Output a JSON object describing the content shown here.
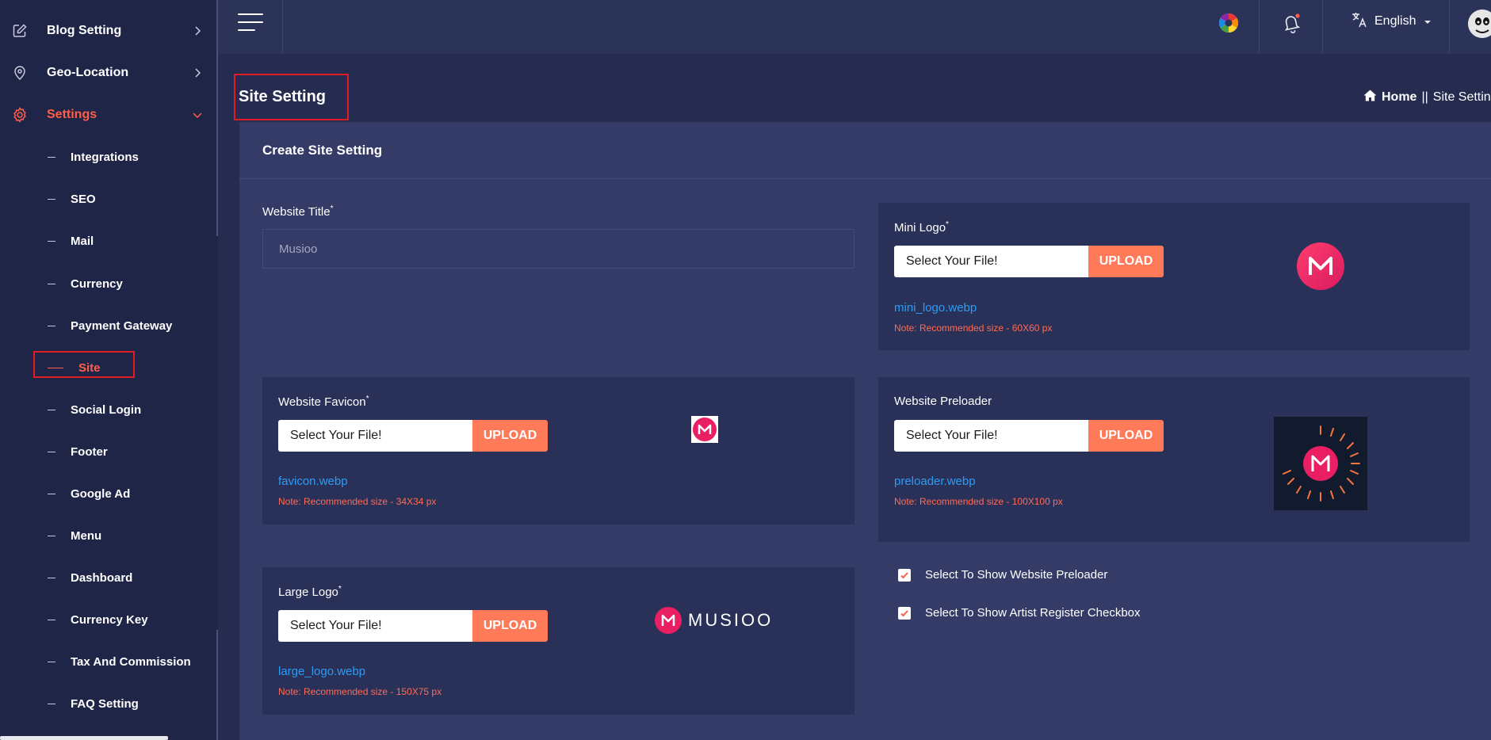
{
  "sidebar": {
    "items": [
      {
        "label": "Blog Setting",
        "icon": "edit-icon"
      },
      {
        "label": "Geo-Location",
        "icon": "location-pin-icon"
      },
      {
        "label": "Settings",
        "icon": "gear-icon"
      }
    ],
    "sub_items": [
      {
        "label": "Integrations"
      },
      {
        "label": "SEO"
      },
      {
        "label": "Mail"
      },
      {
        "label": "Currency"
      },
      {
        "label": "Payment Gateway"
      },
      {
        "label": "Site"
      },
      {
        "label": "Social Login"
      },
      {
        "label": "Footer"
      },
      {
        "label": "Google Ad"
      },
      {
        "label": "Menu"
      },
      {
        "label": "Dashboard"
      },
      {
        "label": "Currency Key"
      },
      {
        "label": "Tax And Commission"
      },
      {
        "label": "FAQ Setting"
      }
    ],
    "active_item": "Settings",
    "active_sub_item": "Site",
    "accent_color": "#ff5f4a"
  },
  "header": {
    "language": "English"
  },
  "page": {
    "title": "Site Setting",
    "breadcrumb": {
      "home": "Home",
      "separator": "||",
      "current": "Site Setting"
    }
  },
  "card": {
    "title": "Create Site Setting",
    "website_title": {
      "label": "Website Title",
      "required": "*",
      "value": "Musioo"
    },
    "mini_logo": {
      "label": "Mini Logo",
      "required": "*",
      "select_label": "Select Your File!",
      "upload_label": "UPLOAD",
      "file_name": "mini_logo.webp",
      "note": "Note: Recommended size - 60X60 px"
    },
    "favicon": {
      "label": "Website Favicon",
      "required": "*",
      "select_label": "Select Your File!",
      "upload_label": "UPLOAD",
      "file_name": "favicon.webp",
      "note": "Note: Recommended size - 34X34 px"
    },
    "preloader": {
      "label": "Website Preloader",
      "select_label": "Select Your File!",
      "upload_label": "UPLOAD",
      "file_name": "preloader.webp",
      "note": "Note: Recommended size - 100X100 px"
    },
    "large_logo": {
      "label": "Large Logo",
      "required": "*",
      "select_label": "Select Your File!",
      "upload_label": "UPLOAD",
      "file_name": "large_logo.webp",
      "note": "Note: Recommended size - 150X75 px",
      "brand_text": "MUSIOO"
    },
    "checkboxes": [
      {
        "label": "Select To Show Website Preloader",
        "checked": true
      },
      {
        "label": "Select To Show Artist Register Checkbox",
        "checked": true
      }
    ]
  },
  "colors": {
    "upload_button": "#ff7a59",
    "link": "#2b9cf5",
    "note": "#ff6b56",
    "highlight_box": "#e01b24"
  }
}
